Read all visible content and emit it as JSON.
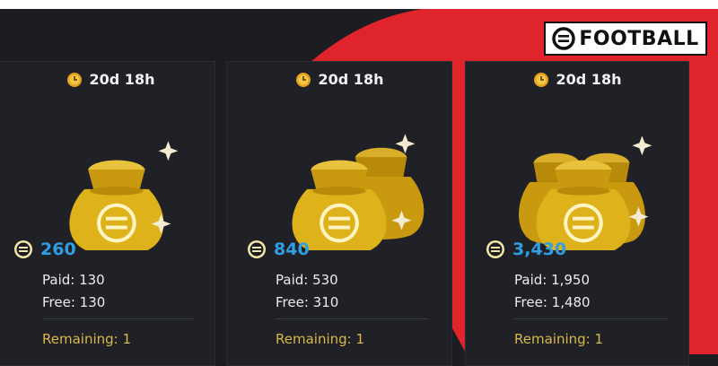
{
  "brand": {
    "logo_text": "FOOTBALL"
  },
  "colors": {
    "background": "#1c1d22",
    "card": "#202127",
    "accent_red": "#e0242c",
    "amount_blue": "#2f9fe3",
    "remaining_gold": "#d8b84a",
    "bag_gold": "#ddb21b"
  },
  "offers": [
    {
      "timer": "20d 18h",
      "amount": "260",
      "paid": "Paid: 130",
      "free": "Free: 130",
      "remaining": "Remaining: 1",
      "bag_count": 1
    },
    {
      "timer": "20d 18h",
      "amount": "840",
      "paid": "Paid: 530",
      "free": "Free: 310",
      "remaining": "Remaining: 1",
      "bag_count": 2
    },
    {
      "timer": "20d 18h",
      "amount": "3,430",
      "paid": "Paid: 1,950",
      "free": "Free: 1,480",
      "remaining": "Remaining: 1",
      "bag_count": 3
    }
  ],
  "icons": {
    "timer": "clock-icon",
    "currency": "efootball-coin-icon",
    "bag": "money-bag-icon",
    "sparkle": "sparkle-icon"
  }
}
